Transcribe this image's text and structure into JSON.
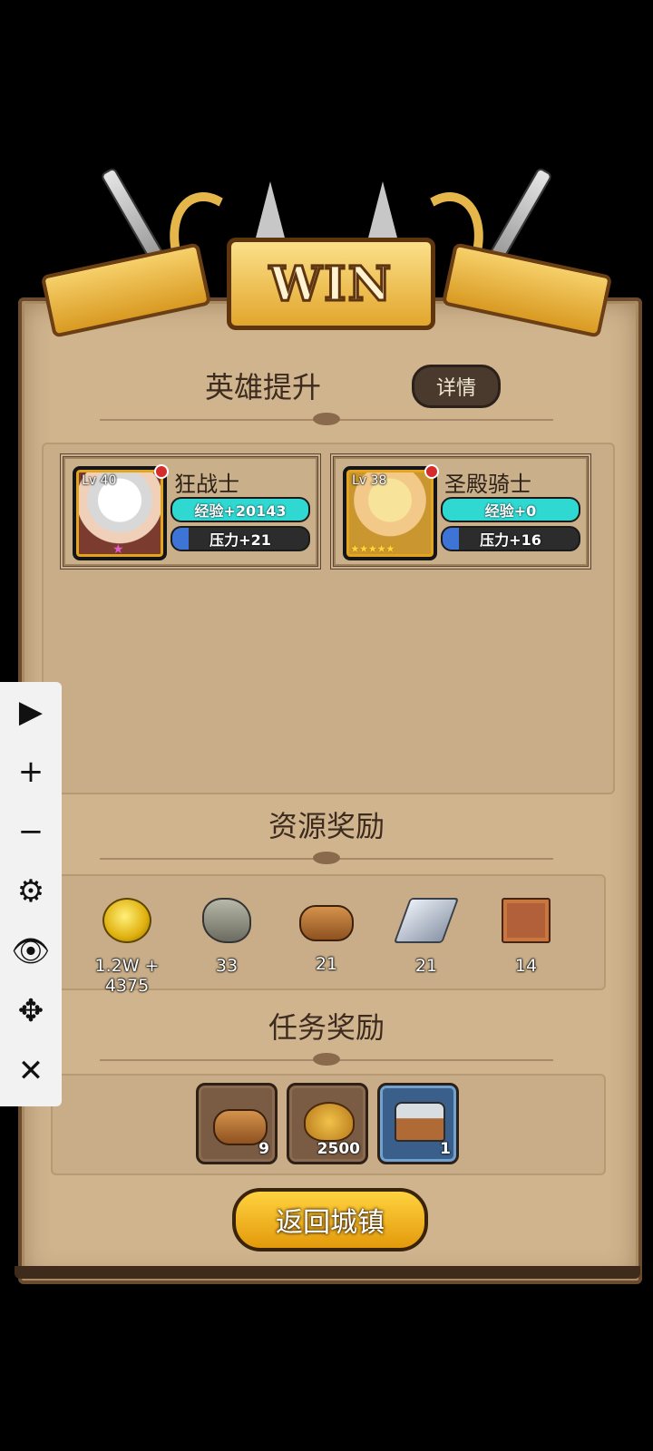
{
  "banner": {
    "title": "WIN"
  },
  "hero_section": {
    "title": "英雄提升",
    "detail_button": "详情",
    "heroes": [
      {
        "name": "狂战士",
        "level": "Lv 40",
        "exp": "经验+20143",
        "exp_fill": 1.0,
        "pressure": "压力+21",
        "pressure_fill": 0.12
      },
      {
        "name": "圣殿骑士",
        "level": "Lv 38",
        "exp": "经验+0",
        "exp_fill": 1.0,
        "pressure": "压力+16",
        "pressure_fill": 0.12,
        "stars": "★★★★★"
      }
    ]
  },
  "resource_section": {
    "title": "资源奖励",
    "items": [
      {
        "icon": "gold-coin-icon",
        "label": "1.2W + 4375"
      },
      {
        "icon": "stone-icon",
        "label": "33"
      },
      {
        "icon": "wood-log-icon",
        "label": "21"
      },
      {
        "icon": "iron-ingot-icon",
        "label": "21"
      },
      {
        "icon": "cloth-icon",
        "label": "14"
      }
    ]
  },
  "task_section": {
    "title": "任务奖励",
    "items": [
      {
        "icon": "wood-log-icon",
        "count": "9"
      },
      {
        "icon": "gold-bag-icon",
        "count": "2500"
      },
      {
        "icon": "treasure-chest-icon",
        "count": "1"
      }
    ]
  },
  "return_button": "返回城镇",
  "toolbar": {
    "play": "▶",
    "zoom_in": "+",
    "zoom_out": "−",
    "settings": "⚙",
    "eye": "👁",
    "move": "✥",
    "close": "✕"
  },
  "colors": {
    "exp_bar": "#2fd9d2",
    "pressure_bar": "#3d74d6",
    "gold": "#f2b51d",
    "parchment": "#cfb48e"
  }
}
